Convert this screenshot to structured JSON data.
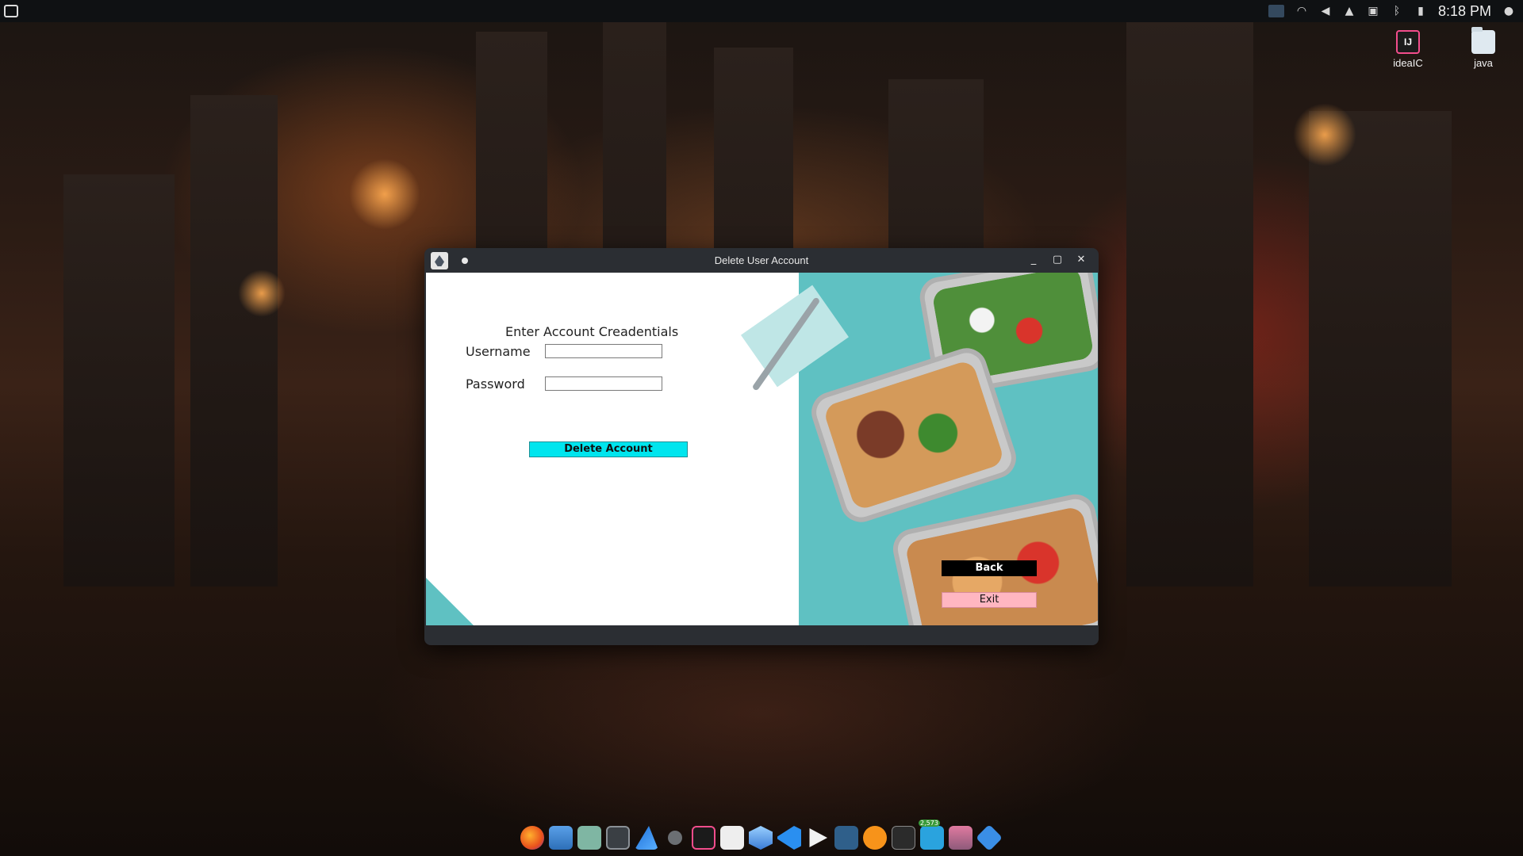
{
  "top_panel": {
    "clock": "8:18 PM"
  },
  "desktop": {
    "icons": [
      {
        "label": "ideaIC",
        "glyph": "IJ"
      },
      {
        "label": "java"
      }
    ]
  },
  "window": {
    "title": "Delete User Account",
    "controls": {
      "minimize": "_",
      "maximize": "▢",
      "close": "✕"
    },
    "form": {
      "heading": "Enter Account Creadentials",
      "username_label": "Username",
      "username_value": "",
      "password_label": "Password",
      "password_value": "",
      "delete_label": "Delete Account",
      "back_label": "Back",
      "exit_label": "Exit"
    }
  },
  "colors": {
    "delete_button": "#00e5ee",
    "back_button": "#000000",
    "exit_button": "#ffb6c1",
    "photo_accent": "#5fc1c2"
  },
  "dock": {
    "apps": [
      {
        "icon": "firefox-icon"
      },
      {
        "icon": "software-manager-icon"
      },
      {
        "icon": "files-icon"
      },
      {
        "icon": "terminal-icon"
      },
      {
        "icon": "shark-icon"
      },
      {
        "icon": "settings-icon"
      },
      {
        "icon": "intellij-icon"
      },
      {
        "icon": "text-editor-icon"
      },
      {
        "icon": "hexagon-app-icon"
      },
      {
        "icon": "vscode-icon"
      },
      {
        "icon": "media-player-icon"
      },
      {
        "icon": "mysql-workbench-icon"
      },
      {
        "icon": "bitcoin-icon"
      },
      {
        "icon": "mm-app-icon"
      },
      {
        "icon": "telegram-icon"
      },
      {
        "icon": "archive-icon"
      },
      {
        "icon": "diamond-app-icon"
      }
    ],
    "badge": "2,573"
  }
}
